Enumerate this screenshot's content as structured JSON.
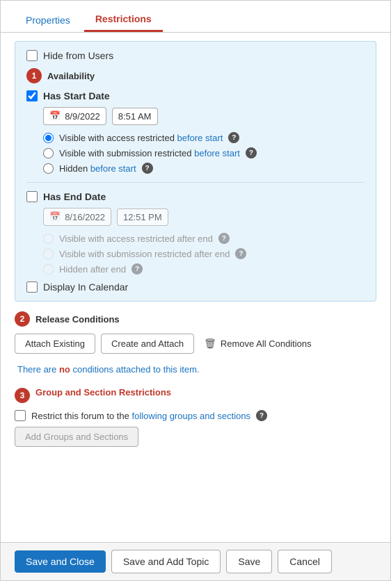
{
  "tabs": [
    {
      "id": "properties",
      "label": "Properties",
      "active": false
    },
    {
      "id": "restrictions",
      "label": "Restrictions",
      "active": true
    }
  ],
  "hideFromUsers": {
    "label": "Hide from Users",
    "checked": false
  },
  "availability": {
    "sectionNumber": "1",
    "sectionTitle": "Availability",
    "hasStartDate": {
      "label": "Has Start Date",
      "checked": true,
      "date": "8/9/2022",
      "time": "8:51 AM",
      "options": [
        {
          "id": "visible-access-restricted-before",
          "labelPre": "Visible with access restricted",
          "labelLink": "before start",
          "checked": true,
          "disabled": false
        },
        {
          "id": "visible-submission-restricted-before",
          "labelPre": "Visible with submission restricted",
          "labelLink": "before start",
          "checked": false,
          "disabled": false
        },
        {
          "id": "hidden-before-start",
          "labelPre": "Hidden",
          "labelLink": "before start",
          "checked": false,
          "disabled": false
        }
      ]
    },
    "hasEndDate": {
      "label": "Has End Date",
      "checked": false,
      "date": "8/16/2022",
      "time": "12:51 PM",
      "options": [
        {
          "id": "visible-access-restricted-after",
          "labelPre": "Visible with access restricted",
          "labelLink": "after end",
          "checked": false,
          "disabled": true
        },
        {
          "id": "visible-submission-restricted-after",
          "labelPre": "Visible with submission restricted",
          "labelLink": "after end",
          "checked": false,
          "disabled": true
        },
        {
          "id": "hidden-after-end",
          "labelPre": "Hidden",
          "labelLink": "after end",
          "checked": false,
          "disabled": true
        }
      ]
    },
    "displayInCalendar": {
      "label": "Display In Calendar",
      "checked": false
    }
  },
  "releaseConditions": {
    "sectionNumber": "2",
    "sectionTitle": "Release Conditions",
    "attachExistingLabel": "Attach Existing",
    "createAttachLabel": "Create and Attach",
    "removeAllLabel": "Remove All Conditions",
    "noConditionsMessage": "There are no conditions attached to this item."
  },
  "groupRestrictions": {
    "sectionNumber": "3",
    "sectionTitle": "Group and Section Restrictions",
    "restrictLabel1": "Restrict this forum to the",
    "restrictLabelLink": "following groups and sections",
    "checked": false,
    "addGroupsLabel": "Add Groups and Sections"
  },
  "footer": {
    "saveAndCloseLabel": "Save and Close",
    "saveAndAddTopicLabel": "Save and Add Topic",
    "saveLabel": "Save",
    "cancelLabel": "Cancel"
  }
}
